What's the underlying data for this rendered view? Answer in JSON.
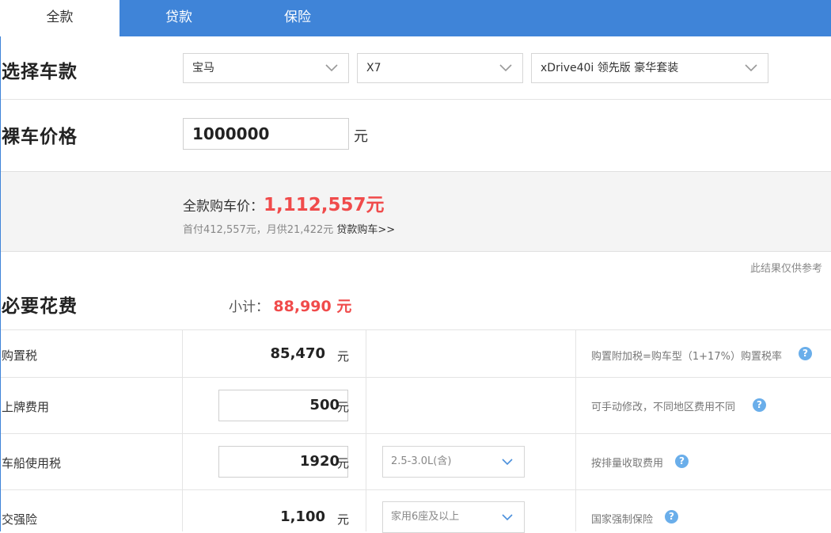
{
  "tabs": [
    {
      "label": "全款"
    },
    {
      "label": "贷款"
    },
    {
      "label": "保险"
    }
  ],
  "select_model": {
    "heading": "选择车款",
    "brand": "宝马",
    "series": "X7",
    "trim": "xDrive40i 领先版 豪华套装"
  },
  "bare_price": {
    "heading": "裸车价格",
    "value": "1000000",
    "unit": "元"
  },
  "summary": {
    "total_label": "全款购车价：",
    "total_value": "1,112,557元",
    "detail": "首付412,557元，月供21,422元",
    "loan_link": "贷款购车>>"
  },
  "disclaimer": "此结果仅供参考",
  "required_costs": {
    "heading": "必要花费",
    "subtotal_label": "小计：",
    "subtotal_value": "88,990 元",
    "rows": [
      {
        "label": "购置税",
        "value": "85,470",
        "unit": "元",
        "note": "购置附加税=购车型（1+17%）购置税率"
      },
      {
        "label": "上牌费用",
        "value": "500",
        "unit": "元",
        "note": "可手动修改，不同地区费用不同"
      },
      {
        "label": "车船使用税",
        "value": "1920",
        "unit": "元",
        "option": "2.5-3.0L(含)",
        "note": "按排量收取费用"
      },
      {
        "label": "交强险",
        "value": "1,100",
        "unit": "元",
        "option": "家用6座及以上",
        "note": "国家强制保险"
      }
    ]
  },
  "colors": {
    "tab_bar": "#3f84d8",
    "accent_red": "#f04b4b",
    "help_icon": "#6aaeea"
  },
  "icons": {
    "dropdown": "chevron-down-icon",
    "help": "question-icon"
  }
}
